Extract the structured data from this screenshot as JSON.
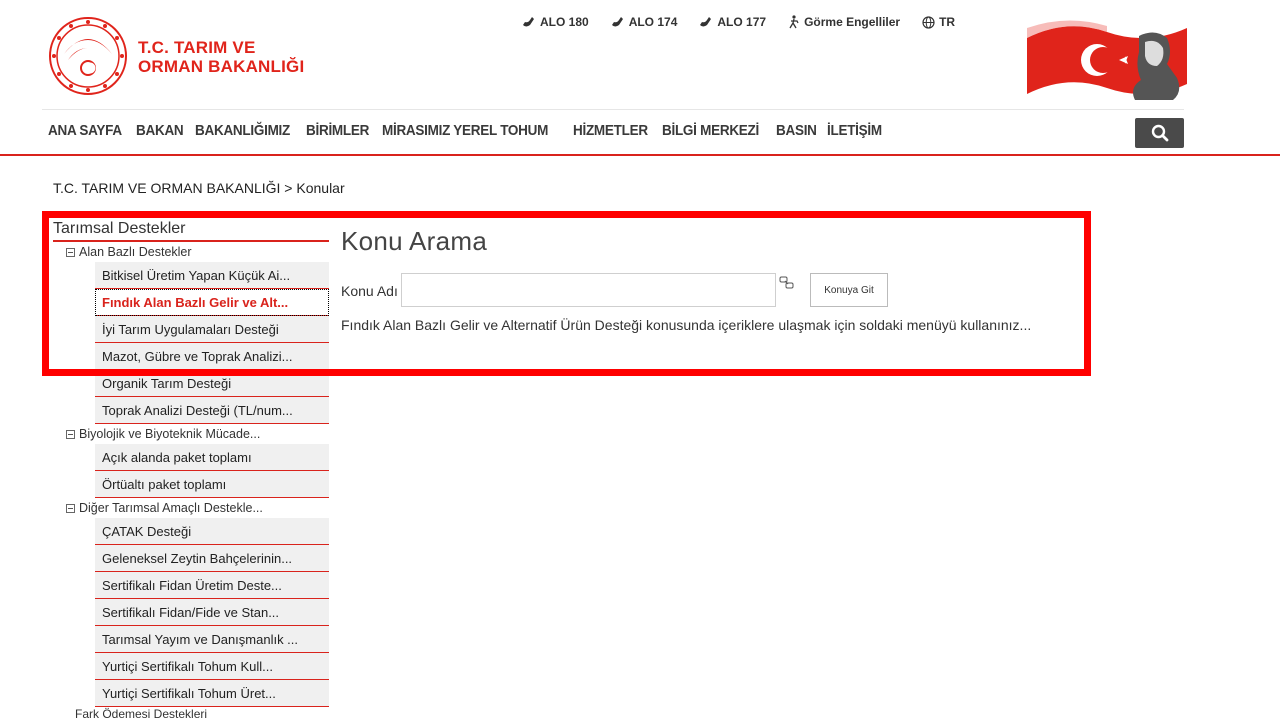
{
  "header": {
    "brand_line1": "T.C. TARIM VE",
    "brand_line2": "ORMAN BAKANLIĞI",
    "top_links": [
      {
        "label": "ALO 180",
        "icon": "phone-icon"
      },
      {
        "label": "ALO 174",
        "icon": "phone-icon"
      },
      {
        "label": "ALO 177",
        "icon": "phone-icon"
      },
      {
        "label": "Görme Engelliler",
        "icon": "accessibility-icon"
      },
      {
        "label": "TR",
        "icon": "globe-icon"
      }
    ],
    "accent_color": "#d9231c"
  },
  "nav": {
    "items": [
      "ANA SAYFA",
      "BAKAN",
      "BAKANLIĞIMIZ",
      "BİRİMLER",
      "MİRASIMIZ YEREL TOHUM",
      "HİZMETLER",
      "BİLGİ MERKEZİ",
      "BASIN",
      "İLETİŞİM"
    ]
  },
  "breadcrumb": "T.C. TARIM VE ORMAN BAKANLIĞI > Konular",
  "sidebar": {
    "title": "Tarımsal Destekler",
    "groups": [
      {
        "label": "Alan Bazlı Destekler",
        "items": [
          "Bitkisel Üretim Yapan Küçük Ai...",
          "Fındık Alan Bazlı Gelir ve Alt...",
          "İyi Tarım Uygulamaları Desteği",
          "Mazot, Gübre ve Toprak Analizi...",
          "Organik Tarım Desteği",
          "Toprak Analizi Desteği (TL/num..."
        ]
      },
      {
        "label": "Biyolojik ve Biyoteknik Mücade...",
        "items": [
          "Açık alanda paket toplamı",
          "Örtüaltı paket toplamı"
        ]
      },
      {
        "label": "Diğer Tarımsal Amaçlı Destekle...",
        "items": [
          "ÇATAK Desteği",
          "Geleneksel Zeytin Bahçelerinin...",
          "Sertifikalı Fidan Üretim Deste...",
          "Sertifikalı Fidan/Fide ve Stan...",
          "Tarımsal Yayım ve Danışmanlık ...",
          "Yurtiçi Sertifikalı Tohum Kull...",
          "Yurtiçi Sertifikalı Tohum Üret..."
        ]
      }
    ],
    "last_item": "Fark Ödemesi Destekleri",
    "active_item": "Fındık Alan Bazlı Gelir ve Alt..."
  },
  "main": {
    "title": "Konu Arama",
    "konu_label": "Konu Adı",
    "konu_value": "",
    "go_button": "Konuya Git",
    "info_text": "Fındık Alan Bazlı Gelir ve Alternatif Ürün Desteği konusunda içeriklere ulaşmak için soldaki menüyü kullanınız..."
  },
  "highlight_color": "#ff0000"
}
